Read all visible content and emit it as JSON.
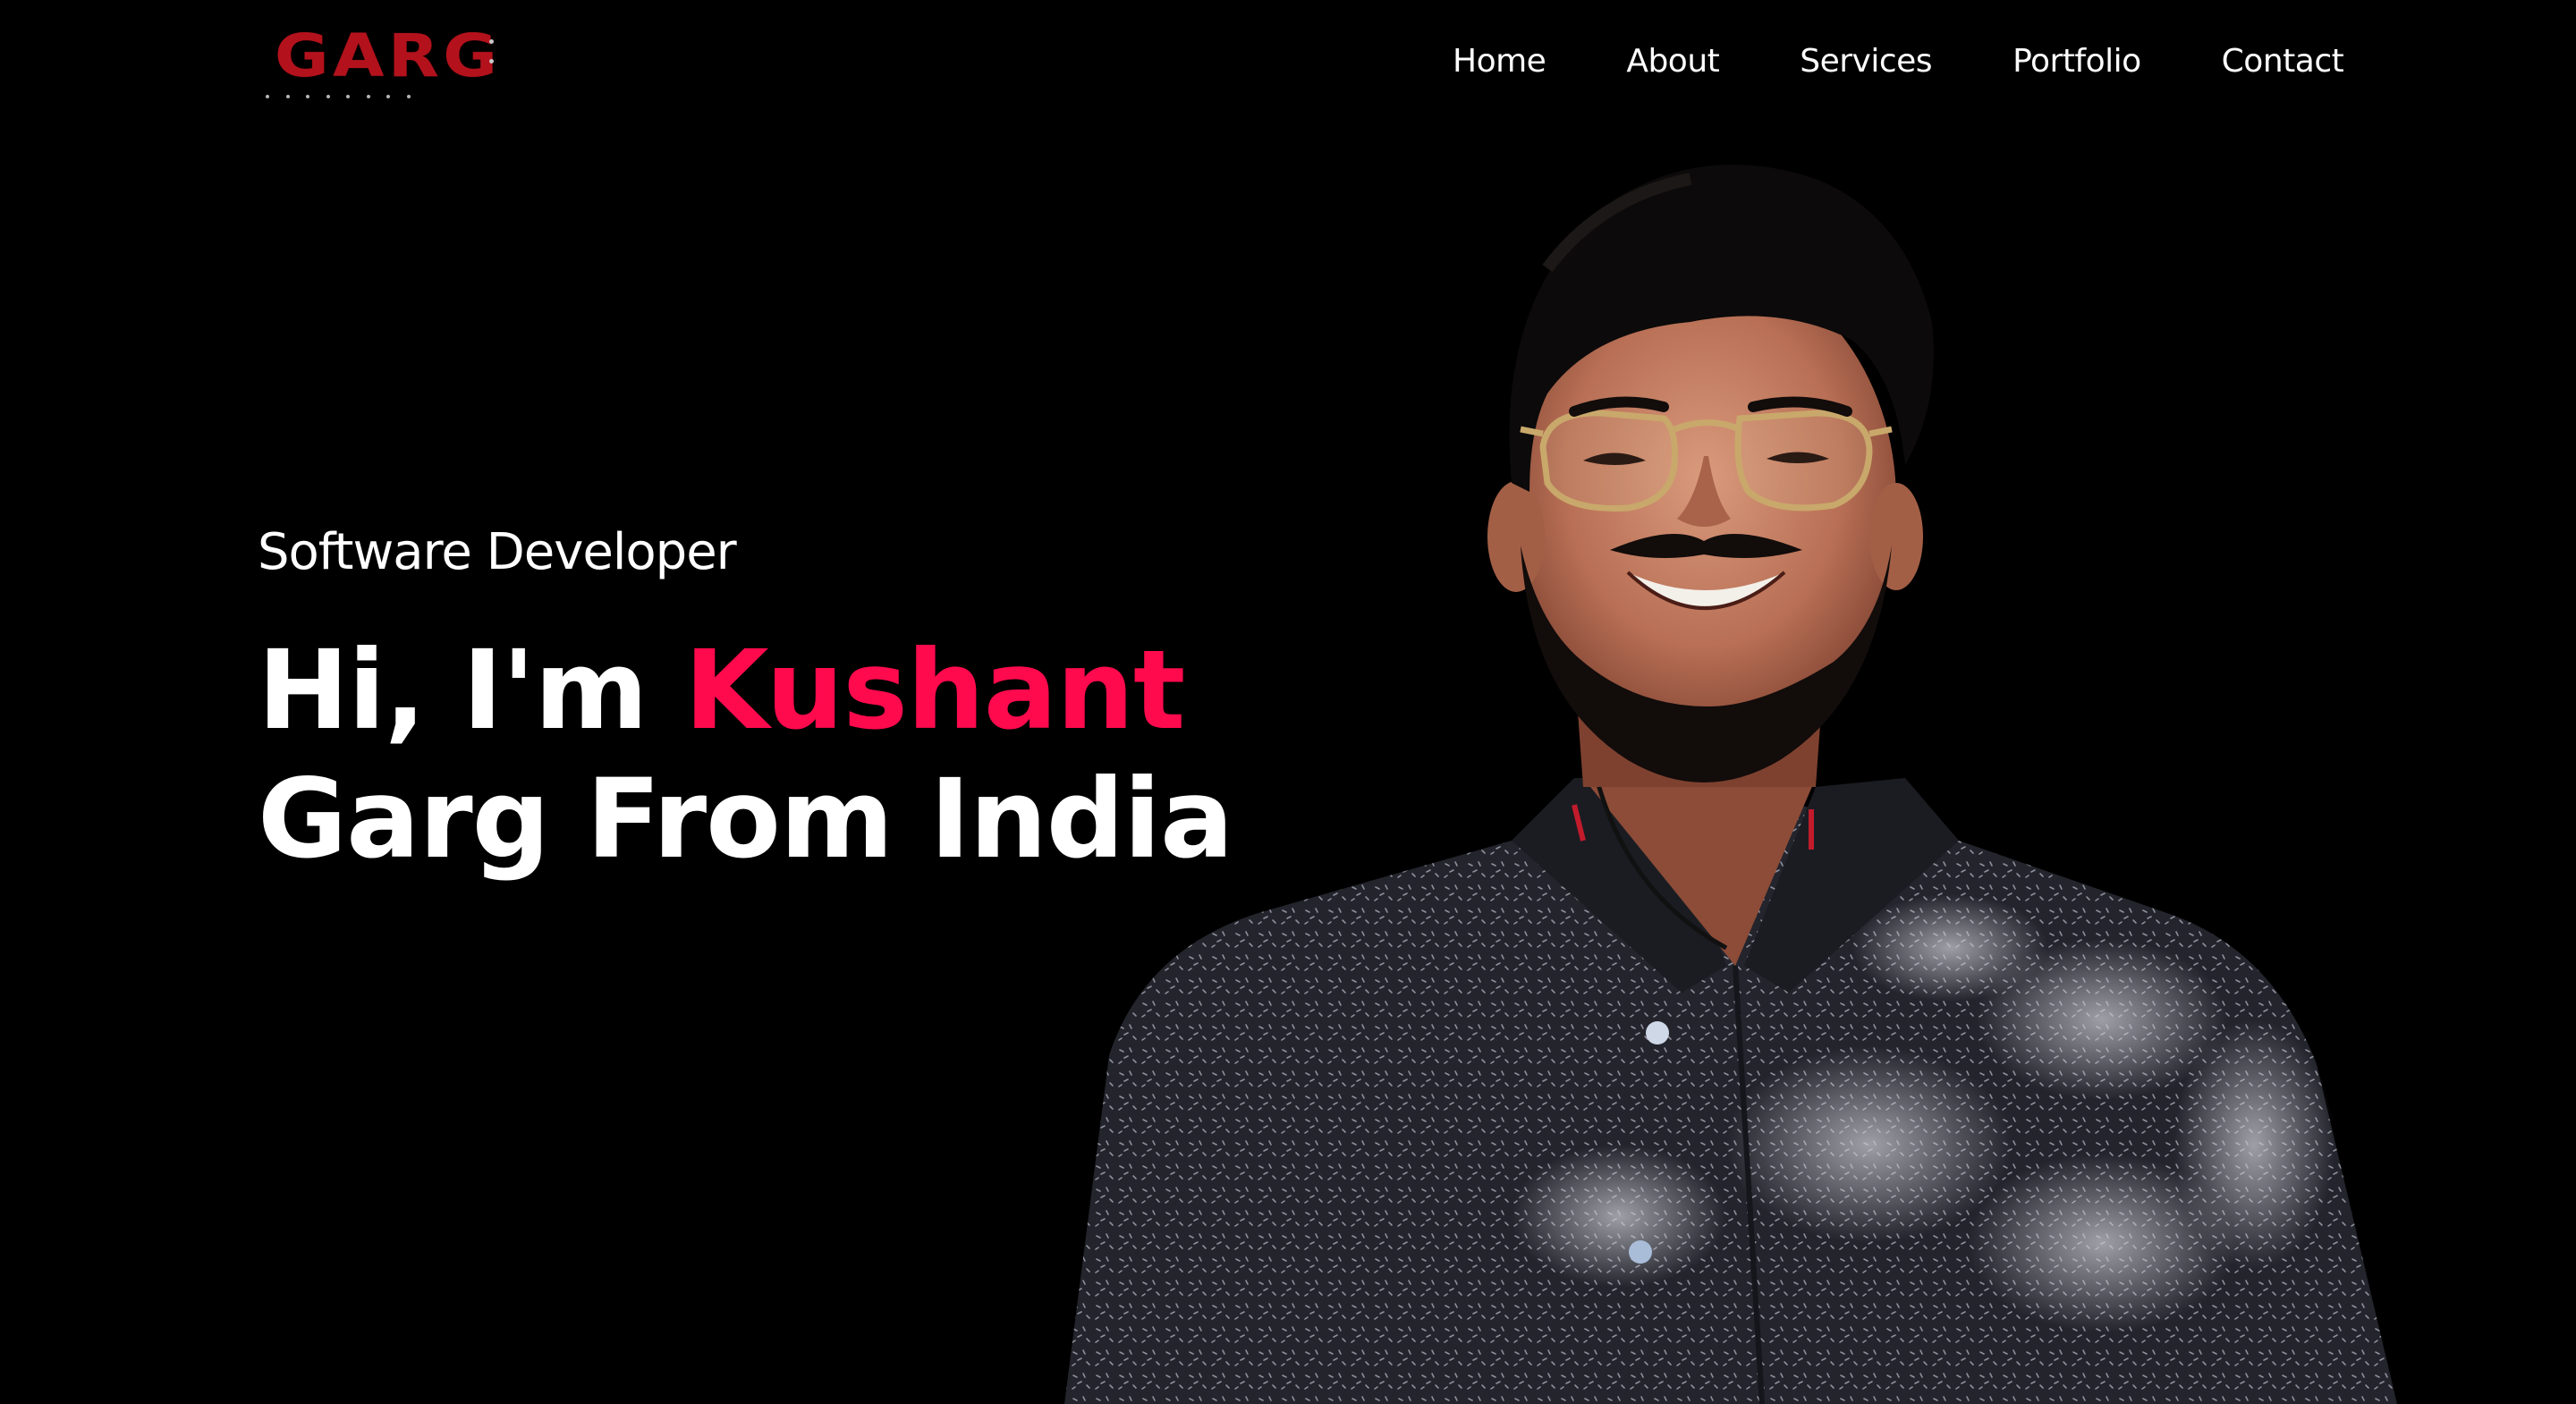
{
  "header": {
    "logo_text": "GARG",
    "nav": [
      "Home",
      "About",
      "Services",
      "Portfolio",
      "Contact"
    ]
  },
  "hero": {
    "role": "Software Developer",
    "greeting": "Hi, I'm ",
    "name": "Kushant",
    "line2": "Garg From India"
  },
  "portrait": {
    "icon": "person-photo"
  },
  "colors": {
    "background": "#000000",
    "accent": "#ff0a4d",
    "logo": "#b3121c",
    "text": "#ffffff"
  }
}
